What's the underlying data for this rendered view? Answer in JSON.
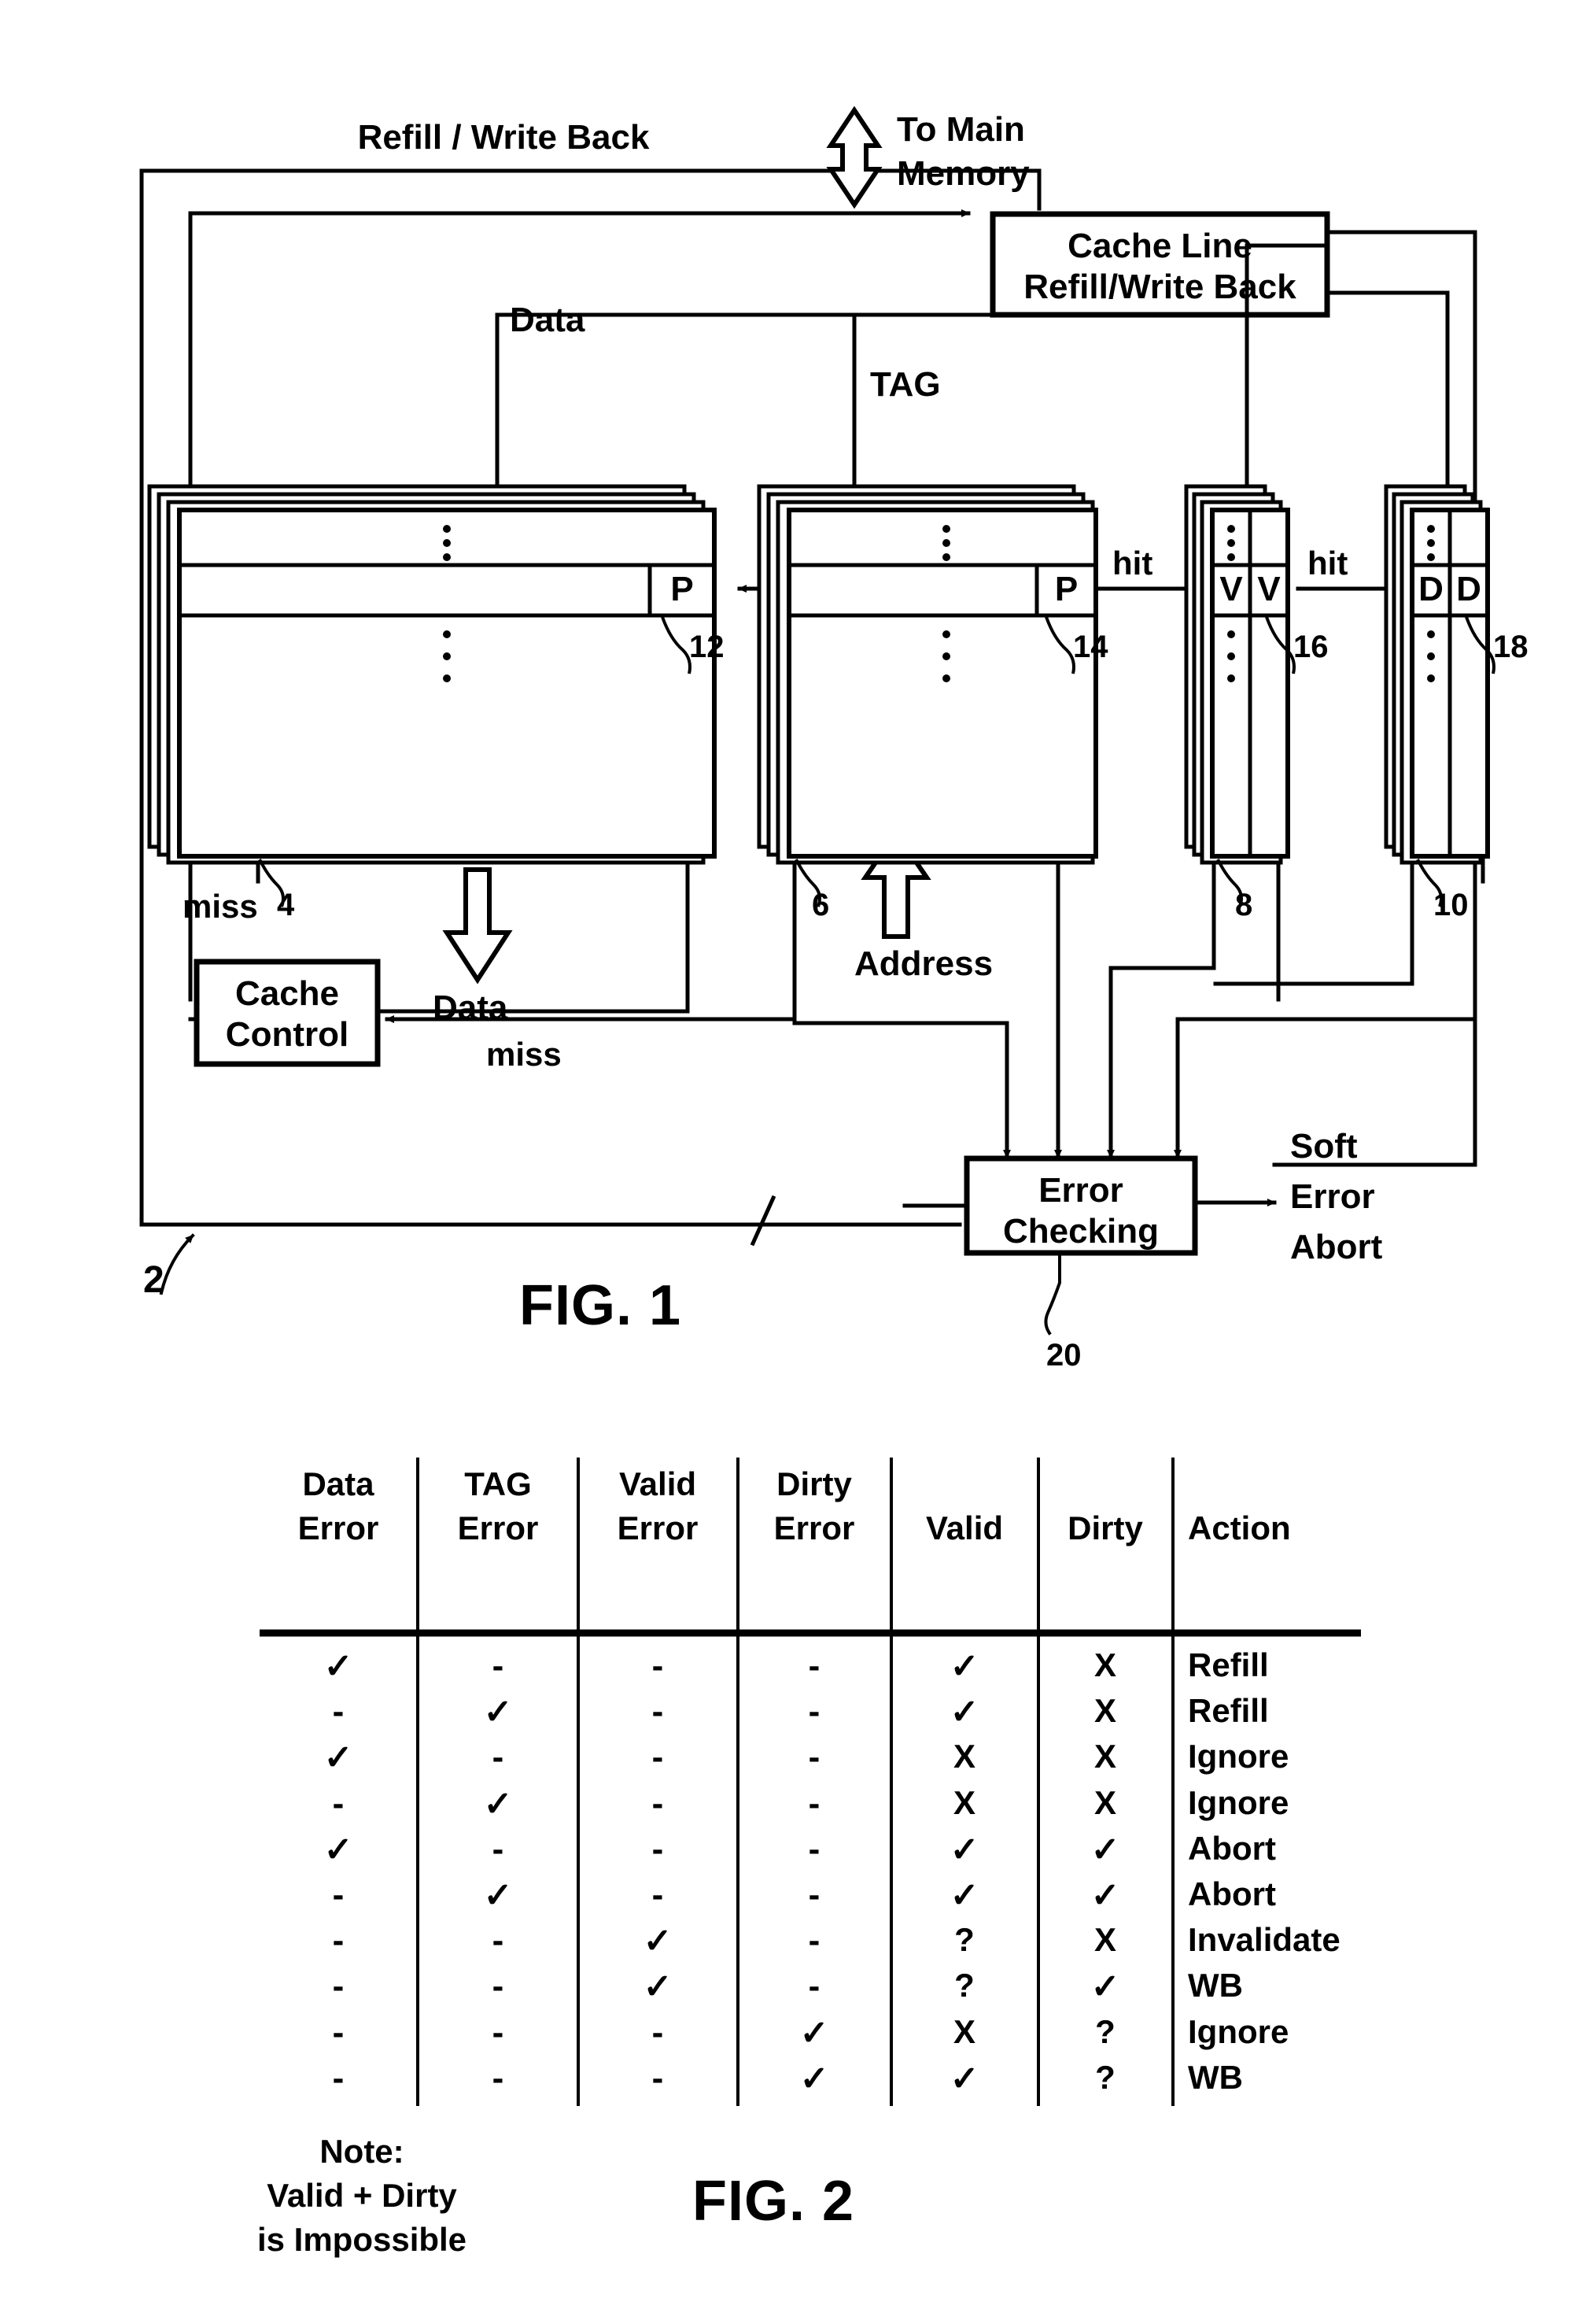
{
  "figure1": {
    "caption": "FIG. 1",
    "ref_system": "2",
    "labels": {
      "refill_write_back": "Refill / Write Back",
      "to_main_memory_line1": "To Main",
      "to_main_memory_line2": "Memory",
      "data_in": "Data",
      "tag_in": "TAG",
      "hit_1": "hit",
      "hit_2": "hit",
      "miss_left": "miss",
      "miss_bottom": "miss",
      "data_out": "Data",
      "address": "Address",
      "soft": "Soft",
      "error": "Error",
      "abort": "Abort"
    },
    "boxes": {
      "cache_line_refill": {
        "line1": "Cache Line",
        "line2": "Refill/Write Back"
      },
      "cache_control": {
        "line1": "Cache",
        "line2": "Control"
      },
      "error_checking": {
        "line1": "Error",
        "line2": "Checking",
        "ref": "20"
      }
    },
    "arrays": [
      {
        "name": "data-array",
        "ref": "4",
        "parity_ref": "12",
        "cells": [
          "P"
        ]
      },
      {
        "name": "tag-array",
        "ref": "6",
        "parity_ref": "14",
        "cells": [
          "P"
        ]
      },
      {
        "name": "valid-array",
        "ref": "8",
        "parity_ref": "16",
        "cells": [
          "V",
          "V"
        ]
      },
      {
        "name": "dirty-array",
        "ref": "10",
        "parity_ref": "18",
        "cells": [
          "D",
          "D"
        ]
      }
    ]
  },
  "figure2": {
    "caption": "FIG. 2",
    "columns": [
      "Data\nError",
      "TAG\nError",
      "Valid\nError",
      "Dirty\nError",
      "Valid",
      "Dirty",
      "Action"
    ],
    "rows": [
      [
        "✓",
        "-",
        "-",
        "-",
        "✓",
        "X",
        "Refill"
      ],
      [
        "-",
        "✓",
        "-",
        "-",
        "✓",
        "X",
        "Refill"
      ],
      [
        "✓",
        "-",
        "-",
        "-",
        "X",
        "X",
        "Ignore"
      ],
      [
        "-",
        "✓",
        "-",
        "-",
        "X",
        "X",
        "Ignore"
      ],
      [
        "✓",
        "-",
        "-",
        "-",
        "✓",
        "✓",
        "Abort"
      ],
      [
        "-",
        "✓",
        "-",
        "-",
        "✓",
        "✓",
        "Abort"
      ],
      [
        "-",
        "-",
        "✓",
        "-",
        "?",
        "X",
        "Invalidate"
      ],
      [
        "-",
        "-",
        "✓",
        "-",
        "?",
        "✓",
        "WB"
      ],
      [
        "-",
        "-",
        "-",
        "✓",
        "X",
        "?",
        "Ignore"
      ],
      [
        "-",
        "-",
        "-",
        "✓",
        "✓",
        "?",
        "WB"
      ]
    ],
    "note": {
      "line1": "Note:",
      "line2": "Valid + Dirty",
      "line3": "is Impossible"
    }
  },
  "chart_data": {
    "type": "table",
    "title": "FIG. 2 - Cache soft error action table",
    "columns": [
      "Data Error",
      "TAG Error",
      "Valid Error",
      "Dirty Error",
      "Valid",
      "Dirty",
      "Action"
    ],
    "rows": [
      [
        "check",
        "dash",
        "dash",
        "dash",
        "check",
        "X",
        "Refill"
      ],
      [
        "dash",
        "check",
        "dash",
        "dash",
        "check",
        "X",
        "Refill"
      ],
      [
        "check",
        "dash",
        "dash",
        "dash",
        "X",
        "X",
        "Ignore"
      ],
      [
        "dash",
        "check",
        "dash",
        "dash",
        "X",
        "X",
        "Ignore"
      ],
      [
        "check",
        "dash",
        "dash",
        "dash",
        "check",
        "check",
        "Abort"
      ],
      [
        "dash",
        "check",
        "dash",
        "dash",
        "check",
        "check",
        "Abort"
      ],
      [
        "dash",
        "dash",
        "check",
        "dash",
        "?",
        "X",
        "Invalidate"
      ],
      [
        "dash",
        "dash",
        "check",
        "dash",
        "?",
        "check",
        "WB"
      ],
      [
        "dash",
        "dash",
        "dash",
        "check",
        "X",
        "?",
        "Ignore"
      ],
      [
        "dash",
        "dash",
        "dash",
        "check",
        "check",
        "?",
        "WB"
      ]
    ]
  },
  "colors": {
    "ink": "#000000",
    "paper": "#ffffff"
  }
}
